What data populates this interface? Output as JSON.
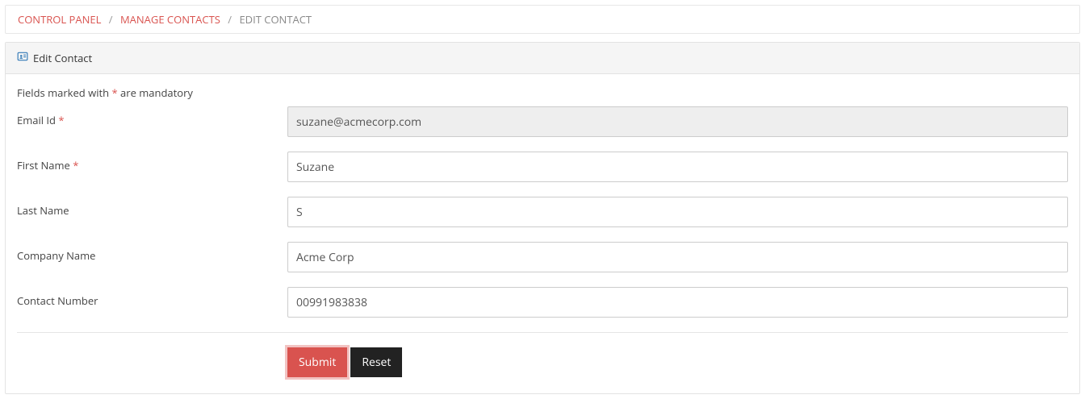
{
  "breadcrumb": {
    "items": [
      {
        "label": "CONTROL PANEL",
        "type": "link"
      },
      {
        "label": "MANAGE CONTACTS",
        "type": "link"
      },
      {
        "label": "EDIT CONTACT",
        "type": "current"
      }
    ]
  },
  "panel": {
    "title": "Edit Contact",
    "mandatory_note_prefix": "Fields marked with ",
    "mandatory_note_asterisk": "*",
    "mandatory_note_suffix": " are mandatory"
  },
  "form": {
    "email": {
      "label": "Email Id ",
      "required": "*",
      "value": "suzane@acmecorp.com"
    },
    "first_name": {
      "label": "First Name ",
      "required": "*",
      "value": "Suzane"
    },
    "last_name": {
      "label": "Last Name",
      "value": "S"
    },
    "company": {
      "label": "Company Name",
      "value": "Acme Corp"
    },
    "contact_number": {
      "label": "Contact Number",
      "value": "00991983838"
    }
  },
  "buttons": {
    "submit": "Submit",
    "reset": "Reset"
  }
}
